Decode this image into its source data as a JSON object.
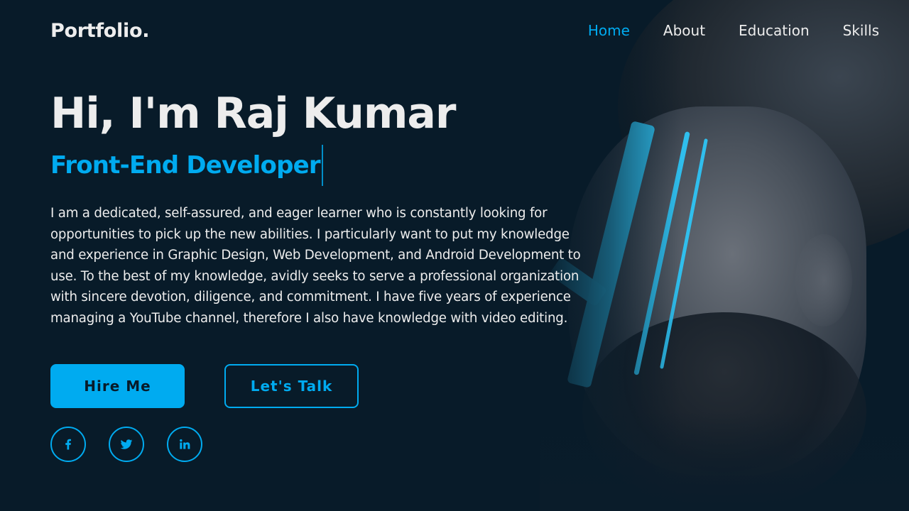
{
  "header": {
    "logo": "Portfolio.",
    "nav": [
      {
        "label": "Home",
        "active": true
      },
      {
        "label": "About",
        "active": false
      },
      {
        "label": "Education",
        "active": false
      },
      {
        "label": "Skills",
        "active": false
      }
    ]
  },
  "hero": {
    "greeting": "Hi, I'm Raj Kumar",
    "role": "Front-End Developer",
    "bio": "I am a dedicated, self-assured, and eager learner who is constantly looking for opportunities to pick up the new abilities. I particularly want to put my knowledge and experience in Graphic Design, Web Development, and Android Development to use. To the best of my knowledge, avidly seeks to serve a professional organization with sincere devotion, diligence, and commitment. I have five years of experience managing a YouTube channel, therefore I also have knowledge with video editing.",
    "buttons": {
      "primary": "Hire Me",
      "secondary": "Let's Talk"
    },
    "socials": [
      {
        "icon": "facebook-icon"
      },
      {
        "icon": "twitter-icon"
      },
      {
        "icon": "linkedin-icon"
      }
    ],
    "portrait_alt": "Man with blue face paint stripes"
  },
  "colors": {
    "background": "#081b29",
    "accent": "#00abf0",
    "text": "#ededed"
  }
}
